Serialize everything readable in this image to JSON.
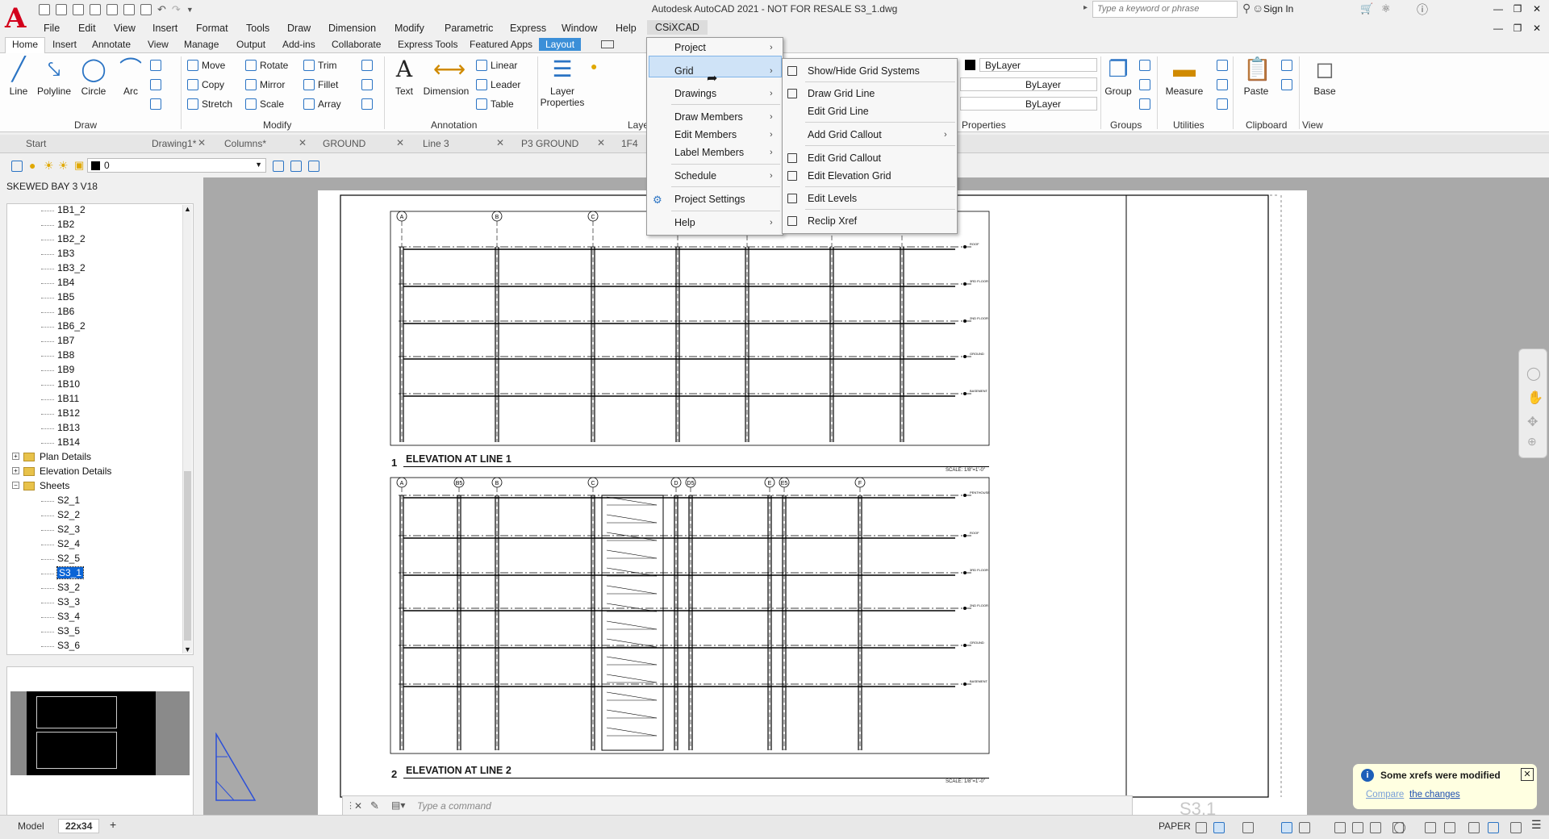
{
  "window": {
    "title": "Autodesk AutoCAD 2021 - NOT FOR RESALE   S3_1.dwg",
    "search_placeholder": "Type a keyword or phrase",
    "sign_in": "Sign In"
  },
  "menubar": [
    "File",
    "Edit",
    "View",
    "Insert",
    "Format",
    "Tools",
    "Draw",
    "Dimension",
    "Modify",
    "Parametric",
    "Express",
    "Window",
    "Help",
    "CSiXCAD"
  ],
  "ribbon_tabs": [
    "Home",
    "Insert",
    "Annotate",
    "View",
    "Manage",
    "Output",
    "Add-ins",
    "Collaborate",
    "Express Tools",
    "Featured Apps",
    "Layout"
  ],
  "ribbon": {
    "draw": {
      "title": "Draw",
      "line": "Line",
      "polyline": "Polyline",
      "circle": "Circle",
      "arc": "Arc"
    },
    "modify": {
      "title": "Modify",
      "move": "Move",
      "copy": "Copy",
      "stretch": "Stretch",
      "rotate": "Rotate",
      "mirror": "Mirror",
      "scale": "Scale",
      "trim": "Trim",
      "fillet": "Fillet",
      "array": "Array"
    },
    "annotation": {
      "title": "Annotation",
      "text": "Text",
      "dimension": "Dimension",
      "linear": "Linear",
      "leader": "Leader",
      "table": "Table"
    },
    "layers": {
      "title": "Laye",
      "layer_properties": "Layer Properties"
    },
    "properties": {
      "title": "Properties",
      "bylayer1": "ByLayer",
      "bylayer2": "ByLayer",
      "bylayer3": "ByLayer"
    },
    "groups": {
      "title": "Groups",
      "group": "Group"
    },
    "utilities": {
      "title": "Utilities",
      "measure": "Measure"
    },
    "clipboard": {
      "title": "Clipboard",
      "paste": "Paste"
    },
    "view": {
      "title": "View",
      "base": "Base"
    }
  },
  "doc_tabs": [
    "Start",
    "Drawing1*",
    "Columns*",
    "GROUND",
    "Line 3",
    "P3 GROUND",
    "1F4"
  ],
  "layer_bar": {
    "current": "0"
  },
  "tree": {
    "header": "SKEWED BAY 3 V18",
    "items": [
      "1B1_2",
      "1B2",
      "1B2_2",
      "1B3",
      "1B3_2",
      "1B4",
      "1B5",
      "1B6",
      "1B6_2",
      "1B7",
      "1B8",
      "1B9",
      "1B10",
      "1B11",
      "1B12",
      "1B13",
      "1B14"
    ],
    "folders": [
      "Plan Details",
      "Elevation Details",
      "Sheets"
    ],
    "sheets": [
      "S2_1",
      "S2_2",
      "S2_3",
      "S2_4",
      "S2_5",
      "S3_1",
      "S3_2",
      "S3_3",
      "S3_4",
      "S3_5",
      "S3_6"
    ],
    "selected": "S3_1"
  },
  "csixcad_menu": [
    "Project",
    "Grid",
    "Drawings",
    "Draw Members",
    "Edit Members",
    "Label Members",
    "Schedule",
    "Project Settings",
    "Help"
  ],
  "grid_submenu": [
    "Show/Hide Grid Systems",
    "Draw Grid Line",
    "Edit Grid Line",
    "Add Grid Callout",
    "Edit Grid Callout",
    "Edit Elevation Grid",
    "Edit Levels",
    "Reclip Xref"
  ],
  "drawing": {
    "elev1": {
      "num": "1",
      "title": "ELEVATION AT LINE 1",
      "scale": "SCALE: 1/8\"=1'-0\"",
      "grids": [
        "A",
        "B",
        "C"
      ],
      "levels": [
        "ROOF",
        "3RD FLOOR",
        "2ND FLOOR",
        "GROUND",
        "BASEMENT"
      ]
    },
    "elev2": {
      "num": "2",
      "title": "ELEVATION AT LINE 2",
      "scale": "SCALE: 1/8\"=1'-0\"",
      "grids": [
        "A",
        "B5",
        "B",
        "C",
        "D",
        "D5",
        "E",
        "E5",
        "F"
      ],
      "levels": [
        "PENTHOUSE",
        "ROOF",
        "3RD FLOOR",
        "2ND FLOOR",
        "GROUND",
        "BASEMENT"
      ]
    },
    "sheet_number": "S3.1"
  },
  "command": {
    "placeholder": "Type a command"
  },
  "notification": {
    "title": "Some xrefs were modified",
    "link_a": "Compare",
    "link_b": "the changes"
  },
  "status": {
    "model": "Model",
    "layout": "22x34",
    "add": "+",
    "paper": "PAPER"
  }
}
